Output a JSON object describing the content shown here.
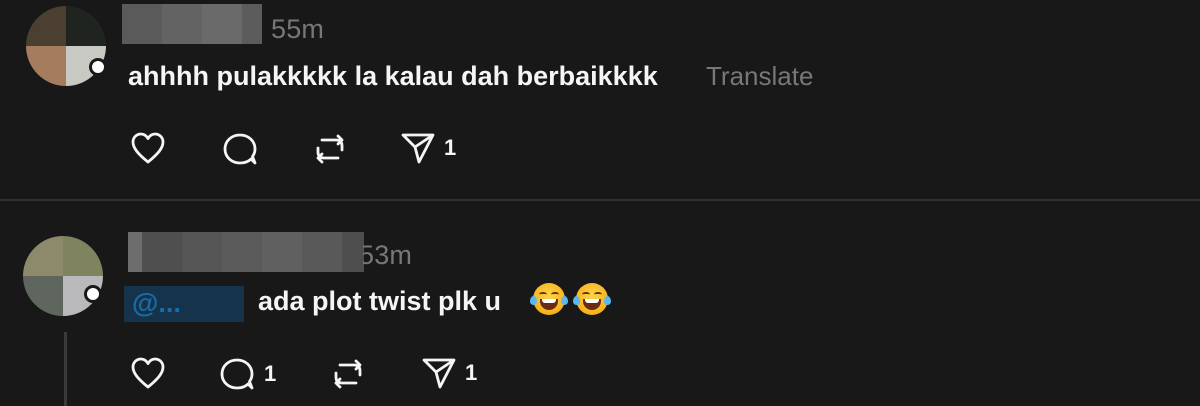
{
  "posts": [
    {
      "timestamp": "55m",
      "text": "ahhhh pulakkkkk la kalau dah berbaikkkk",
      "translate_label": "Translate",
      "icons": {
        "like": "heart-icon",
        "reply": "comment-icon",
        "repost": "repost-icon",
        "share": "send-icon"
      },
      "counts": {
        "like": "",
        "reply": "",
        "repost": "",
        "share": "1"
      }
    },
    {
      "timestamp": "53m",
      "mention": "@...",
      "text": "ada plot twist plk u",
      "emoji": "rolling-on-floor-laughing-icon",
      "icons": {
        "like": "heart-icon",
        "reply": "comment-icon",
        "repost": "repost-icon",
        "share": "send-icon"
      },
      "counts": {
        "like": "",
        "reply": "1",
        "repost": "",
        "share": "1"
      }
    }
  ],
  "colors": {
    "background": "#181818",
    "text_primary": "#f3f5f7",
    "text_secondary": "#777777",
    "divider": "#323232",
    "mention": "#1d9bf0"
  }
}
